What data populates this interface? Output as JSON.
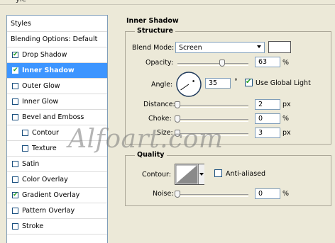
{
  "window": {
    "title_fragment": "yle"
  },
  "styles_panel": {
    "header": "Styles",
    "items": [
      {
        "label": "Blending Options: Default",
        "checkbox": false,
        "checked": false,
        "selected": false
      },
      {
        "label": "Drop Shadow",
        "checkbox": true,
        "checked": true,
        "selected": false
      },
      {
        "label": "Inner Shadow",
        "checkbox": true,
        "checked": true,
        "selected": true
      },
      {
        "label": "Outer Glow",
        "checkbox": true,
        "checked": false,
        "selected": false
      },
      {
        "label": "Inner Glow",
        "checkbox": true,
        "checked": false,
        "selected": false
      },
      {
        "label": "Bevel and Emboss",
        "checkbox": true,
        "checked": false,
        "selected": false
      },
      {
        "label": "Contour",
        "checkbox": true,
        "checked": false,
        "selected": false,
        "indent": true
      },
      {
        "label": "Texture",
        "checkbox": true,
        "checked": false,
        "selected": false,
        "indent": true
      },
      {
        "label": "Satin",
        "checkbox": true,
        "checked": false,
        "selected": false
      },
      {
        "label": "Color Overlay",
        "checkbox": true,
        "checked": false,
        "selected": false
      },
      {
        "label": "Gradient Overlay",
        "checkbox": true,
        "checked": true,
        "selected": false
      },
      {
        "label": "Pattern Overlay",
        "checkbox": true,
        "checked": false,
        "selected": false
      },
      {
        "label": "Stroke",
        "checkbox": true,
        "checked": false,
        "selected": false
      }
    ]
  },
  "inner_shadow": {
    "title": "Inner Shadow",
    "structure": {
      "legend": "Structure",
      "blend_mode": {
        "label": "Blend Mode:",
        "value": "Screen",
        "color": "#ffffff"
      },
      "opacity": {
        "label": "Opacity:",
        "value": "63",
        "unit": "%",
        "level": 0.63
      },
      "angle": {
        "label": "Angle:",
        "value": "35",
        "unit": "°",
        "degrees": 35
      },
      "global_light": {
        "label": "Use Global Light",
        "checked": true
      },
      "distance": {
        "label": "Distance:",
        "value": "2",
        "unit": "px",
        "level": 0.0
      },
      "choke": {
        "label": "Choke:",
        "value": "0",
        "unit": "%",
        "level": 0.0
      },
      "size": {
        "label": "Size:",
        "value": "3",
        "unit": "px",
        "level": 0.0
      }
    },
    "quality": {
      "legend": "Quality",
      "contour": {
        "label": "Contour:"
      },
      "anti_aliased": {
        "label": "Anti-aliased",
        "checked": false
      },
      "noise": {
        "label": "Noise:",
        "value": "0",
        "unit": "%",
        "level": 0.0
      }
    }
  },
  "watermark": {
    "text": "Alfoart.com"
  },
  "colors": {
    "selection": "#3d95ff",
    "panel_bg": "#ece9d8",
    "check": "#21a121"
  }
}
